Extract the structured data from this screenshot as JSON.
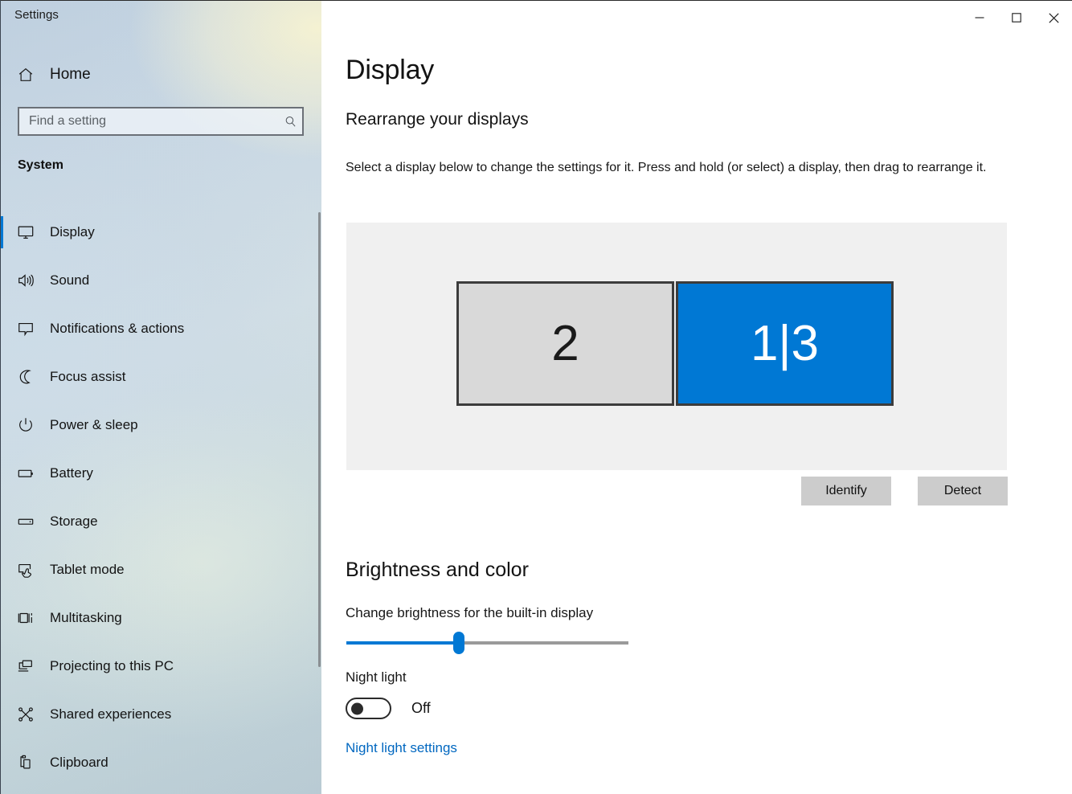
{
  "window": {
    "title": "Settings",
    "controls": [
      {
        "name": "minimize",
        "label": "—"
      },
      {
        "name": "maximize",
        "label": "□"
      },
      {
        "name": "close",
        "label": "✕"
      }
    ]
  },
  "sidebar": {
    "home_label": "Home",
    "home_icon": "home-icon",
    "search": {
      "placeholder": "Find a setting",
      "value": "",
      "icon": "search-icon"
    },
    "group_title": "System",
    "selected_index": 0,
    "items": [
      {
        "label": "Display",
        "icon": "monitor-icon",
        "selected": true
      },
      {
        "label": "Sound",
        "icon": "speaker-icon",
        "selected": false
      },
      {
        "label": "Notifications & actions",
        "icon": "notification-icon",
        "selected": false
      },
      {
        "label": "Focus assist",
        "icon": "moon-icon",
        "selected": false
      },
      {
        "label": "Power & sleep",
        "icon": "power-icon",
        "selected": false
      },
      {
        "label": "Battery",
        "icon": "battery-icon",
        "selected": false
      },
      {
        "label": "Storage",
        "icon": "storage-icon",
        "selected": false
      },
      {
        "label": "Tablet mode",
        "icon": "tablet-icon",
        "selected": false
      },
      {
        "label": "Multitasking",
        "icon": "multitasking-icon",
        "selected": false
      },
      {
        "label": "Projecting to this PC",
        "icon": "projecting-icon",
        "selected": false
      },
      {
        "label": "Shared experiences",
        "icon": "share-icon",
        "selected": false
      },
      {
        "label": "Clipboard",
        "icon": "clipboard-icon",
        "selected": false
      }
    ]
  },
  "main": {
    "page_title": "Display",
    "rearrange": {
      "heading": "Rearrange your displays",
      "description": "Select a display below to change the settings for it. Press and hold (or select) a display, then drag to rearrange it.",
      "displays": [
        {
          "label": "2",
          "selected": false
        },
        {
          "label": "1|3",
          "selected": true
        }
      ],
      "identify_label": "Identify",
      "detect_label": "Detect"
    },
    "brightness": {
      "heading": "Brightness and color",
      "slider_label": "Change brightness for the built-in display",
      "slider_percent": 40,
      "night_light_label": "Night light",
      "night_light_state": "Off",
      "night_light_on": false,
      "night_light_settings_link": "Night light settings"
    }
  },
  "colors": {
    "accent": "#0078d4",
    "link": "#0067c0",
    "panel_bg": "#f0f0f0",
    "button_bg": "#cccccc",
    "display_unselected_bg": "#d9d9d9",
    "display_border": "#3c3c3c",
    "slider_track": "#9a9a9a"
  }
}
